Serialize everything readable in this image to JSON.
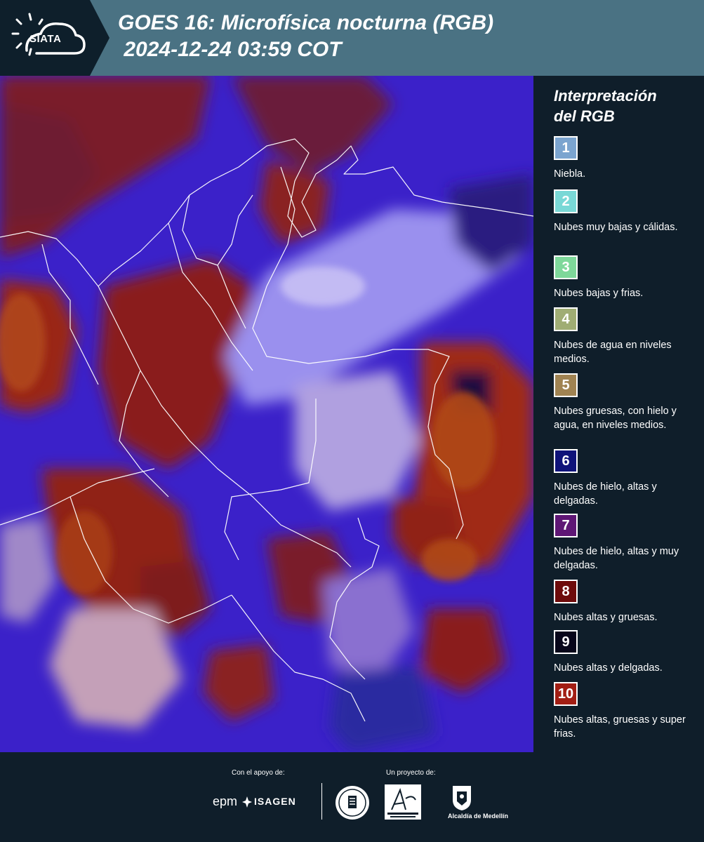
{
  "header": {
    "logo_text": "SIATA",
    "title_line1": "GOES 16: Microfísica nocturna (RGB)",
    "title_line2": " 2024-12-24 03:59 COT"
  },
  "legend": {
    "title_line1": "Interpretación",
    "title_line2": "del RGB",
    "items": [
      {
        "number": "1",
        "label": "Niebla.",
        "color": "#7ba4cf"
      },
      {
        "number": "2",
        "label": "Nubes muy bajas y cálidas.",
        "color": "#79d8d6"
      },
      {
        "number": "3",
        "label": "Nubes bajas y frias.",
        "color": "#7ed89a"
      },
      {
        "number": "4",
        "label": "Nubes de agua en niveles medios.",
        "color": "#a0ad74"
      },
      {
        "number": "5",
        "label": "Nubes gruesas, con hielo y agua, en niveles medios.",
        "color": "#a08352"
      },
      {
        "number": "6",
        "label": "Nubes de hielo, altas y delgadas.",
        "color": "#0f137a"
      },
      {
        "number": "7",
        "label": "Nubes de hielo, altas y muy delgadas.",
        "color": "#5e1675"
      },
      {
        "number": "8",
        "label": "Nubes altas y gruesas.",
        "color": "#6e0b0b"
      },
      {
        "number": "9",
        "label": "Nubes altas y delgadas.",
        "color": "#07061a"
      },
      {
        "number": "10",
        "label": "Nubes altas, gruesas y super frias.",
        "color": "#a21e14"
      }
    ]
  },
  "footer": {
    "support_label": "Con el apoyo de:",
    "project_label": "Un proyecto de:",
    "sponsor_epm": "epm",
    "sponsor_isagen": "ISAGEN",
    "partner_alcaldia": "Alcaldía de Medellín"
  }
}
